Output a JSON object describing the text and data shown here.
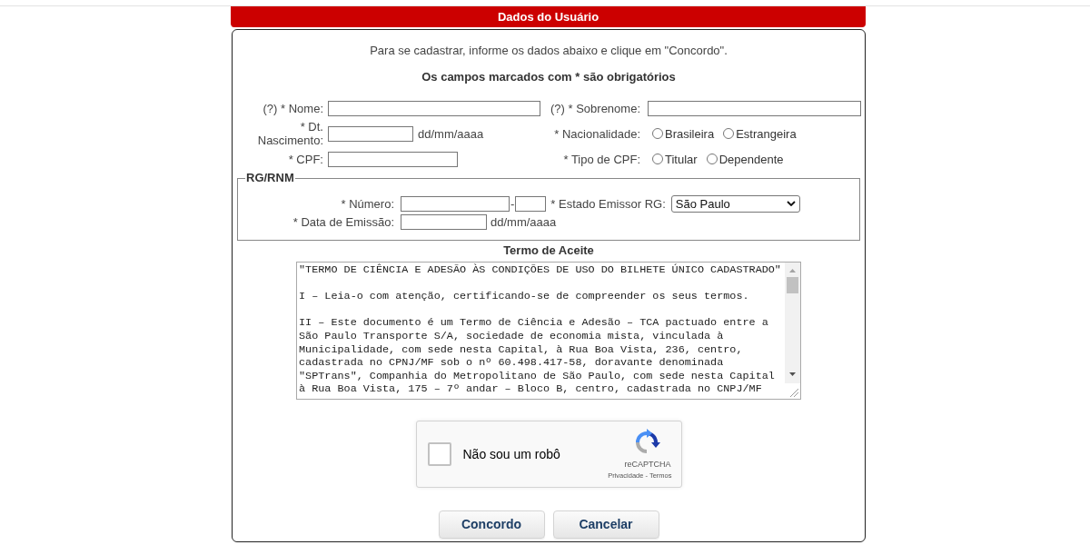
{
  "header": {
    "title": "Dados do Usuário"
  },
  "intro": {
    "instruction": "Para se cadastrar, informe os dados abaixo e clique em \"Concordo\".",
    "required_note": "Os campos marcados com * são obrigatórios"
  },
  "personal": {
    "name": {
      "label": "(?) * Nome:"
    },
    "surname": {
      "label": "(?) * Sobrenome:"
    },
    "birth_date": {
      "label": "* Dt. Nascimento:",
      "format_hint": "dd/mm/aaaa"
    },
    "nationality": {
      "label": "* Nacionalidade:",
      "options": [
        {
          "label": "Brasileira",
          "selected": false
        },
        {
          "label": "Estrangeira",
          "selected": false
        }
      ]
    },
    "cpf": {
      "label": "* CPF:"
    },
    "cpf_type": {
      "label": "* Tipo de CPF:",
      "options": [
        {
          "label": "Titular",
          "selected": false
        },
        {
          "label": "Dependente",
          "selected": false
        }
      ]
    }
  },
  "rg": {
    "legend": "RG/RNM",
    "number": {
      "label": "* Número:",
      "separator": "-"
    },
    "issuer": {
      "label": "* Estado Emissor RG:",
      "value": "São Paulo"
    },
    "issue_date": {
      "label": "* Data de Emissão:",
      "format_hint": "dd/mm/aaaa"
    }
  },
  "terms": {
    "title": "Termo de Aceite",
    "text": "\"TERMO DE CIÊNCIA E ADESÃO ÀS CONDIÇÕES DE USO DO BILHETE ÚNICO CADASTRADO\"\n\nI – Leia-o com atenção, certificando-se de compreender os seus termos.\n\nII – Este documento é um Termo de Ciência e Adesão – TCA pactuado entre a\nSão Paulo Transporte S/A, sociedade de economia mista, vinculada à\nMunicipalidade, com sede nesta Capital, à Rua Boa Vista, 236, centro,\ncadastrada no CPNJ/MF sob o nº 60.498.417-58, doravante denominada\n\"SPTrans\", Companhia do Metropolitano de São Paulo, com sede nesta Capital\nà Rua Boa Vista, 175 – 7º andar – Bloco B, centro, cadastrada no CNPJ/MF"
  },
  "captcha": {
    "label": "Não sou um robô",
    "checked": false,
    "brand": "reCAPTCHA",
    "privacy_link": "Privacidade",
    "separator": "-",
    "terms_link": "Termos"
  },
  "buttons": [
    {
      "label": "Concordo"
    },
    {
      "label": "Cancelar"
    }
  ]
}
